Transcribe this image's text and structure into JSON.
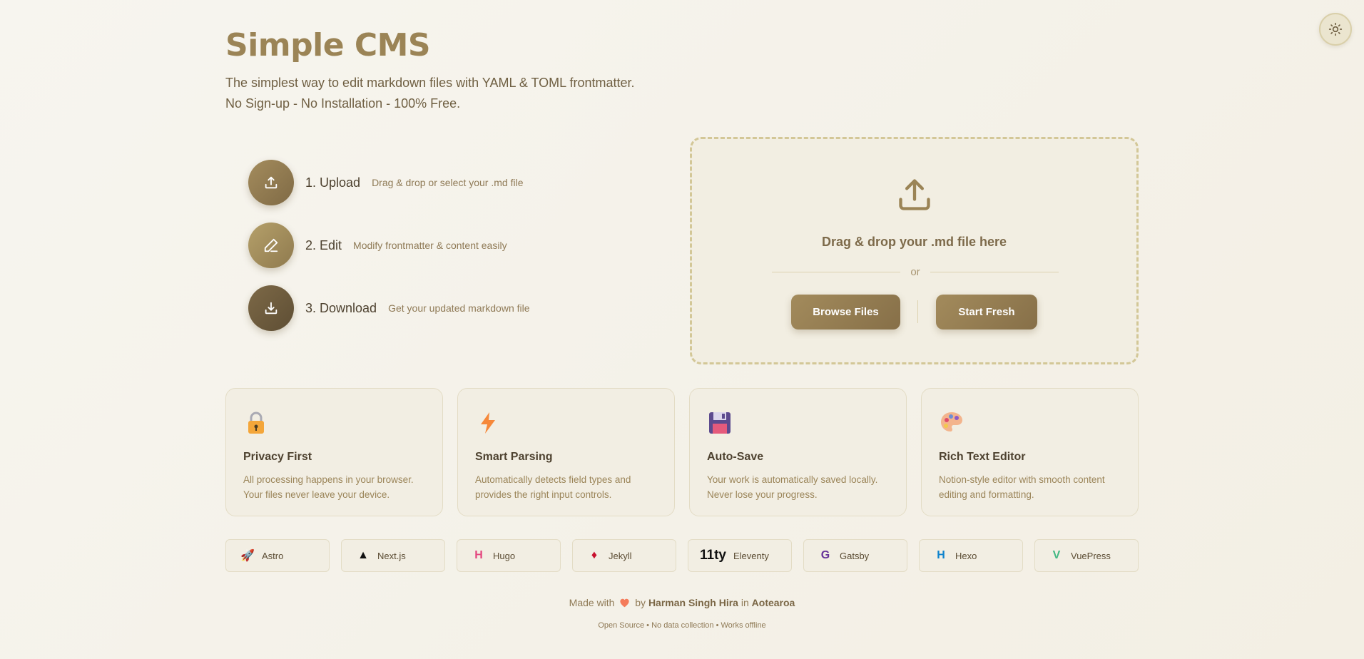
{
  "app": {
    "title": "Simple CMS",
    "subtitle_1": "The simplest way to edit markdown files with YAML & TOML frontmatter.",
    "subtitle_2": "No Sign-up - No Installation - 100% Free."
  },
  "theme_toggle": {
    "icon": "sun-icon"
  },
  "steps": [
    {
      "title": "1. Upload",
      "desc": "Drag & drop or select your .md file",
      "icon": "upload-icon"
    },
    {
      "title": "2. Edit",
      "desc": "Modify frontmatter & content easily",
      "icon": "pencil-icon"
    },
    {
      "title": "3. Download",
      "desc": "Get your updated markdown file",
      "icon": "download-icon"
    }
  ],
  "dropzone": {
    "text": "Drag & drop your .md file here",
    "or": "or",
    "browse_label": "Browse Files",
    "fresh_label": "Start Fresh"
  },
  "features": [
    {
      "title": "Privacy First",
      "desc": "All processing happens in your browser. Your files never leave your device.",
      "icon": "lock-icon"
    },
    {
      "title": "Smart Parsing",
      "desc": "Automatically detects field types and provides the right input controls.",
      "icon": "lightning-icon"
    },
    {
      "title": "Auto-Save",
      "desc": "Your work is automatically saved locally. Never lose your progress.",
      "icon": "floppy-disk-icon"
    },
    {
      "title": "Rich Text Editor",
      "desc": "Notion-style editor with smooth content editing and formatting.",
      "icon": "palette-icon"
    }
  ],
  "frameworks": [
    {
      "name": "Astro",
      "glyph": "🚀",
      "color": "#c0392b"
    },
    {
      "name": "Next.js",
      "glyph": "▲",
      "color": "#111111"
    },
    {
      "name": "Hugo",
      "glyph": "H",
      "color": "#e4477f"
    },
    {
      "name": "Jekyll",
      "glyph": "♦",
      "color": "#c8102e"
    },
    {
      "name": "Eleventy",
      "glyph": "11ty",
      "color": "#111111"
    },
    {
      "name": "Gatsby",
      "glyph": "G",
      "color": "#663399"
    },
    {
      "name": "Hexo",
      "glyph": "H",
      "color": "#0e83cd"
    },
    {
      "name": "VuePress",
      "glyph": "V",
      "color": "#42b883"
    }
  ],
  "footer": {
    "made_with": "Made with",
    "by": "by",
    "author": "Harman Singh Hira",
    "in": "in",
    "place": "Aotearoa",
    "tagline": "Open Source • No data collection • Works offline"
  },
  "colors": {
    "accent": "#9b8456",
    "button": "#977f52",
    "background": "#f5f2ea"
  }
}
